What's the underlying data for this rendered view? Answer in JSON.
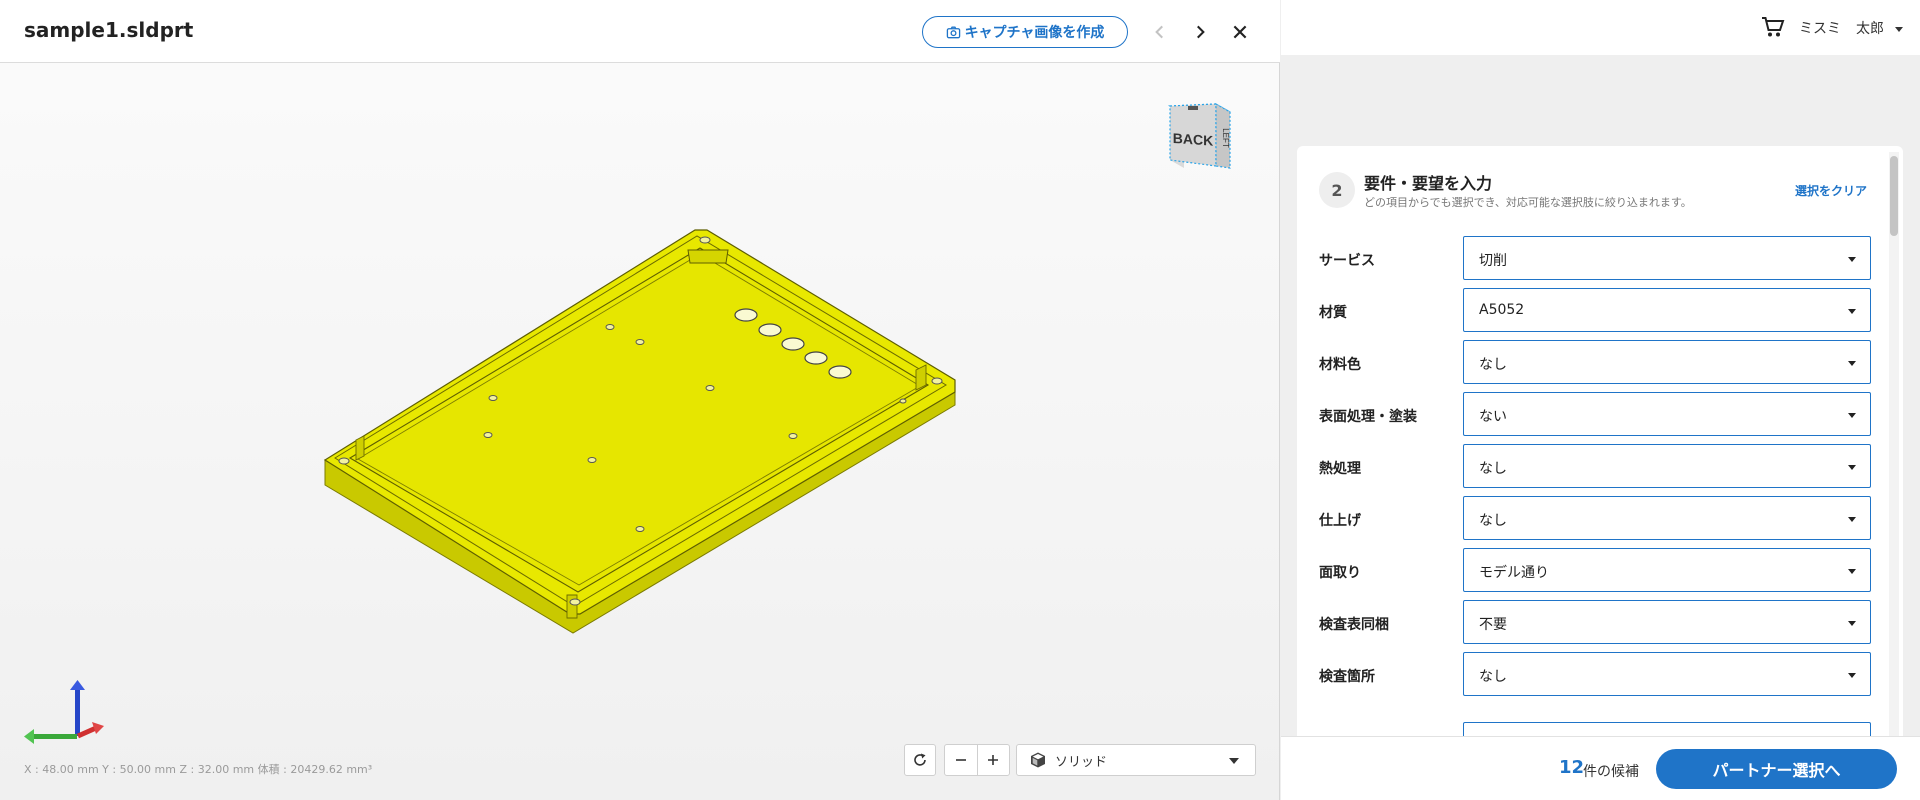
{
  "viewer": {
    "file_title": "sample1.sldprt",
    "capture_label": "キャプチャ画像を作成",
    "status_text": "X : 48.00 mm  Y : 50.00 mm  Z : 32.00 mm  体積 : 20429.62 mm³",
    "render_mode": "ソリッド",
    "view_cube_labels": {
      "front": "BACK",
      "side": "LEFT"
    },
    "model_color": "#e8e800"
  },
  "header": {
    "org": "ミスミ",
    "user": "太郎"
  },
  "form": {
    "step_number": "2",
    "title": "要件・要望を入力",
    "description": "どの項目からでも選択でき、対応可能な選択肢に絞り込まれます。",
    "clear_label": "選択をクリア",
    "fields": [
      {
        "label": "サービス",
        "value": "切削"
      },
      {
        "label": "材質",
        "value": "A5052"
      },
      {
        "label": "材料色",
        "value": "なし"
      },
      {
        "label": "表面処理・塗装",
        "value": "ない"
      },
      {
        "label": "熱処理",
        "value": "なし"
      },
      {
        "label": "仕上げ",
        "value": "なし"
      },
      {
        "label": "面取り",
        "value": "モデル通り"
      },
      {
        "label": "検査表同梱",
        "value": "不要"
      },
      {
        "label": "検査箇所",
        "value": "なし"
      }
    ]
  },
  "footer": {
    "candidate_count": "12",
    "candidate_label": "件の候補",
    "partner_button": "パートナー選択へ"
  },
  "colors": {
    "accent": "#1f74c8",
    "model": "#e8e800"
  }
}
